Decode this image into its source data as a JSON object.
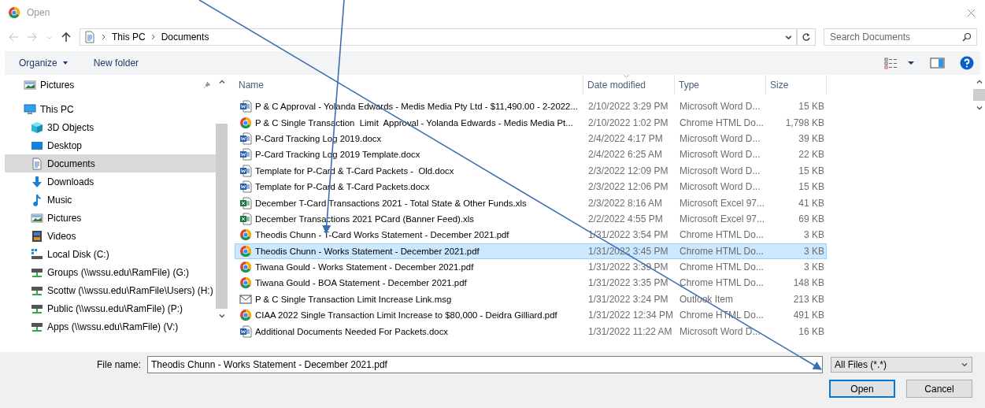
{
  "window": {
    "title": "Open"
  },
  "address": {
    "path": [
      "This PC",
      "Documents"
    ]
  },
  "search": {
    "placeholder": "Search Documents"
  },
  "toolbar": {
    "buttons": [
      {
        "label": "Organize",
        "menu": true
      },
      {
        "label": "New folder",
        "menu": false
      }
    ]
  },
  "sidebar": {
    "items": [
      {
        "label": "Pictures",
        "kind": "pictures",
        "pinned": true,
        "selected": false
      },
      {
        "label": "This PC",
        "kind": "pc",
        "pinned": false,
        "selected": false,
        "children": [
          {
            "label": "3D Objects",
            "kind": "cube",
            "pinned": false,
            "selected": false
          },
          {
            "label": "Desktop",
            "kind": "desktop",
            "pinned": false,
            "selected": false
          },
          {
            "label": "Documents",
            "kind": "documents",
            "pinned": false,
            "selected": true
          },
          {
            "label": "Downloads",
            "kind": "downloads",
            "pinned": false,
            "selected": false
          },
          {
            "label": "Music",
            "kind": "music",
            "pinned": false,
            "selected": false
          },
          {
            "label": "Pictures",
            "kind": "pictures",
            "pinned": false,
            "selected": false
          },
          {
            "label": "Videos",
            "kind": "videos",
            "pinned": false,
            "selected": false
          },
          {
            "label": "Local Disk (C:)",
            "kind": "disk",
            "pinned": false,
            "selected": false
          },
          {
            "label": "Groups (\\\\wssu.edu\\RamFile) (G:)",
            "kind": "netdrive",
            "pinned": false,
            "selected": false
          },
          {
            "label": "Scottw (\\\\wssu.edu\\RamFile\\Users) (H:)",
            "kind": "netdrive",
            "pinned": false,
            "selected": false
          },
          {
            "label": "Public (\\\\wssu.edu\\RamFile) (P:)",
            "kind": "netdrive",
            "pinned": false,
            "selected": false
          },
          {
            "label": "Apps (\\\\wssu.edu\\RamFile) (V:)",
            "kind": "netdrive",
            "pinned": false,
            "selected": false
          }
        ]
      }
    ]
  },
  "columns": [
    {
      "label": "Name",
      "sorted": false
    },
    {
      "label": "Date modified",
      "sorted": true
    },
    {
      "label": "Type",
      "sorted": false
    },
    {
      "label": "Size",
      "sorted": false
    }
  ],
  "files": [
    {
      "name": "P & C Approval - Yolanda Edwards - Medis Media Pty Ltd - $11,490.00 - 2-2022...",
      "date": "2/10/2022 3:29 PM",
      "type": "Microsoft Word D...",
      "size": "15 KB",
      "kind": "word",
      "selected": false
    },
    {
      "name": "P & C Single Transaction  Limit  Approval - Yolanda Edwards - Medis Media Pt...",
      "date": "2/10/2022 1:02 PM",
      "type": "Chrome HTML Do...",
      "size": "1,798 KB",
      "kind": "chrome",
      "selected": false
    },
    {
      "name": "P-Card Tracking Log 2019.docx",
      "date": "2/4/2022 4:17 PM",
      "type": "Microsoft Word D...",
      "size": "39 KB",
      "kind": "word",
      "selected": false
    },
    {
      "name": "P-Card Tracking Log 2019 Template.docx",
      "date": "2/4/2022 6:25 AM",
      "type": "Microsoft Word D...",
      "size": "22 KB",
      "kind": "word",
      "selected": false
    },
    {
      "name": "Template for P-Card & T-Card Packets -  Old.docx",
      "date": "2/3/2022 12:09 PM",
      "type": "Microsoft Word D...",
      "size": "15 KB",
      "kind": "word",
      "selected": false
    },
    {
      "name": "Template for P-Card & T-Card Packets.docx",
      "date": "2/3/2022 12:06 PM",
      "type": "Microsoft Word D...",
      "size": "15 KB",
      "kind": "word",
      "selected": false
    },
    {
      "name": "December T-Card Transactions 2021 - Total State & Other Funds.xls",
      "date": "2/3/2022 8:16 AM",
      "type": "Microsoft Excel 97...",
      "size": "41 KB",
      "kind": "excel",
      "selected": false
    },
    {
      "name": "December Transactions 2021 PCard (Banner Feed).xls",
      "date": "2/2/2022 4:55 PM",
      "type": "Microsoft Excel 97...",
      "size": "69 KB",
      "kind": "excel",
      "selected": false
    },
    {
      "name": "Theodis Chunn - T-Card Works Statement - December 2021.pdf",
      "date": "1/31/2022 3:54 PM",
      "type": "Chrome HTML Do...",
      "size": "3 KB",
      "kind": "chrome",
      "selected": false
    },
    {
      "name": "Theodis Chunn - Works Statement - December 2021.pdf",
      "date": "1/31/2022 3:45 PM",
      "type": "Chrome HTML Do...",
      "size": "3 KB",
      "kind": "chrome",
      "selected": true
    },
    {
      "name": "Tiwana Gould - Works Statement - December 2021.pdf",
      "date": "1/31/2022 3:39 PM",
      "type": "Chrome HTML Do...",
      "size": "3 KB",
      "kind": "chrome",
      "selected": false
    },
    {
      "name": "Tiwana Gould - BOA Statement - December 2021.pdf",
      "date": "1/31/2022 3:35 PM",
      "type": "Chrome HTML Do...",
      "size": "148 KB",
      "kind": "chrome",
      "selected": false
    },
    {
      "name": "P & C Single Transaction Limit Increase Link.msg",
      "date": "1/31/2022 3:24 PM",
      "type": "Outlook Item",
      "size": "213 KB",
      "kind": "mail",
      "selected": false
    },
    {
      "name": "CIAA 2022 Single Transaction Limit Increase to $80,000 - Deidra Gilliard.pdf",
      "date": "1/31/2022 12:34 PM",
      "type": "Chrome HTML Do...",
      "size": "491 KB",
      "kind": "chrome",
      "selected": false
    },
    {
      "name": "Additional Documents Needed For Packets.docx",
      "date": "1/31/2022 11:22 AM",
      "type": "Microsoft Word D...",
      "size": "16 KB",
      "kind": "word",
      "selected": false
    }
  ],
  "file_name": {
    "label": "File name:",
    "value": "Theodis Chunn - Works Statement - December 2021.pdf"
  },
  "filter": {
    "value": "All Files (*.*)"
  },
  "buttons": [
    {
      "label": "Open",
      "default": true
    },
    {
      "label": "Cancel",
      "default": false
    }
  ]
}
